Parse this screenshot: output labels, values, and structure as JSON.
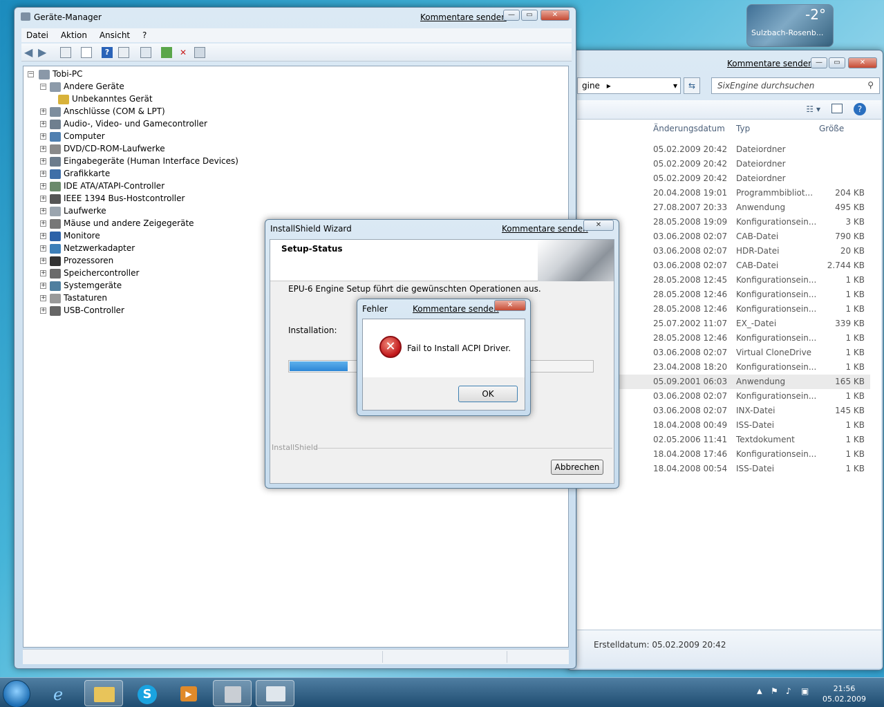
{
  "weather": {
    "temp": "-2°",
    "city": "Sulzbach-Rosenb..."
  },
  "explorer": {
    "feedback": "Kommentare senden",
    "address": "gine",
    "search_placeholder": "SixEngine durchsuchen",
    "columns": {
      "date": "Änderungsdatum",
      "type": "Typ",
      "size": "Größe"
    },
    "rows": [
      {
        "date": "05.02.2009 20:42",
        "type": "Dateiordner",
        "size": ""
      },
      {
        "date": "05.02.2009 20:42",
        "type": "Dateiordner",
        "size": ""
      },
      {
        "date": "05.02.2009 20:42",
        "type": "Dateiordner",
        "size": ""
      },
      {
        "date": "20.04.2008 19:01",
        "type": "Programmbibliot...",
        "size": "204 KB"
      },
      {
        "date": "27.08.2007 20:33",
        "type": "Anwendung",
        "size": "495 KB"
      },
      {
        "date": "28.05.2008 19:09",
        "type": "Konfigurationsein...",
        "size": "3 KB"
      },
      {
        "date": "03.06.2008 02:07",
        "type": "CAB-Datei",
        "size": "790 KB"
      },
      {
        "date": "03.06.2008 02:07",
        "type": "HDR-Datei",
        "size": "20 KB"
      },
      {
        "date": "03.06.2008 02:07",
        "type": "CAB-Datei",
        "size": "2.744 KB"
      },
      {
        "date": "28.05.2008 12:45",
        "type": "Konfigurationsein...",
        "size": "1 KB"
      },
      {
        "date": "28.05.2008 12:46",
        "type": "Konfigurationsein...",
        "size": "1 KB"
      },
      {
        "date": "28.05.2008 12:46",
        "type": "Konfigurationsein...",
        "size": "1 KB"
      },
      {
        "date": "25.07.2002 11:07",
        "type": "EX_-Datei",
        "size": "339 KB"
      },
      {
        "date": "28.05.2008 12:46",
        "type": "Konfigurationsein...",
        "size": "1 KB"
      },
      {
        "date": "03.06.2008 02:07",
        "type": "Virtual CloneDrive",
        "size": "1 KB"
      },
      {
        "date": "23.04.2008 18:20",
        "type": "Konfigurationsein...",
        "size": "1 KB"
      },
      {
        "date": "05.09.2001 06:03",
        "type": "Anwendung",
        "size": "165 KB"
      },
      {
        "date": "03.06.2008 02:07",
        "type": "Konfigurationsein...",
        "size": "1 KB"
      },
      {
        "date": "03.06.2008 02:07",
        "type": "INX-Datei",
        "size": "145 KB"
      },
      {
        "date": "18.04.2008 00:49",
        "type": "ISS-Datei",
        "size": "1 KB"
      },
      {
        "date": "02.05.2006 11:41",
        "type": "Textdokument",
        "size": "1 KB"
      },
      {
        "date": "18.04.2008 17:46",
        "type": "Konfigurationsein...",
        "size": "1 KB"
      },
      {
        "date": "18.04.2008 00:54",
        "type": "ISS-Datei",
        "size": "1 KB"
      }
    ],
    "details": "Erstelldatum: 05.02.2009 20:42"
  },
  "devmgr": {
    "title": "Geräte-Manager",
    "feedback": "Kommentare senden",
    "menu": [
      "Datei",
      "Aktion",
      "Ansicht",
      "?"
    ],
    "root": "Tobi-PC",
    "tree": [
      {
        "label": "Andere Geräte",
        "expanded": true,
        "icon": "other-devices-icon"
      },
      {
        "label": "Unbekanntes Gerät",
        "child": true,
        "icon": "unknown-device-warning-icon"
      },
      {
        "label": "Anschlüsse (COM & LPT)",
        "icon": "port-icon"
      },
      {
        "label": "Audio-, Video- und Gamecontroller",
        "icon": "speaker-icon"
      },
      {
        "label": "Computer",
        "icon": "computer-icon"
      },
      {
        "label": "DVD/CD-ROM-Laufwerke",
        "icon": "dvd-drive-icon"
      },
      {
        "label": "Eingabegeräte (Human Interface Devices)",
        "icon": "hid-icon"
      },
      {
        "label": "Grafikkarte",
        "icon": "display-adapter-icon"
      },
      {
        "label": "IDE ATA/ATAPI-Controller",
        "icon": "ide-controller-icon"
      },
      {
        "label": "IEEE 1394 Bus-Hostcontroller",
        "icon": "firewire-icon"
      },
      {
        "label": "Laufwerke",
        "icon": "disk-drive-icon"
      },
      {
        "label": "Mäuse und andere Zeigegeräte",
        "icon": "mouse-icon"
      },
      {
        "label": "Monitore",
        "icon": "monitor-icon"
      },
      {
        "label": "Netzwerkadapter",
        "icon": "network-adapter-icon"
      },
      {
        "label": "Prozessoren",
        "icon": "processor-icon"
      },
      {
        "label": "Speichercontroller",
        "icon": "storage-controller-icon"
      },
      {
        "label": "Systemgeräte",
        "icon": "system-devices-icon"
      },
      {
        "label": "Tastaturen",
        "icon": "keyboard-icon"
      },
      {
        "label": "USB-Controller",
        "icon": "usb-icon"
      }
    ]
  },
  "wizard": {
    "title": "InstallShield Wizard",
    "feedback": "Kommentare senden",
    "heading": "Setup-Status",
    "message": "EPU-6 Engine Setup führt die gewünschten Operationen aus.",
    "install_label": "Installation:",
    "progress_fraction": 0.19,
    "brand": "InstallShield",
    "cancel": "Abbrechen"
  },
  "error": {
    "title": "Fehler",
    "feedback": "Kommentare senden",
    "message": "Fail to Install ACPI Driver.",
    "ok": "OK"
  },
  "clock": {
    "time": "21:56",
    "date": "05.02.2009"
  }
}
